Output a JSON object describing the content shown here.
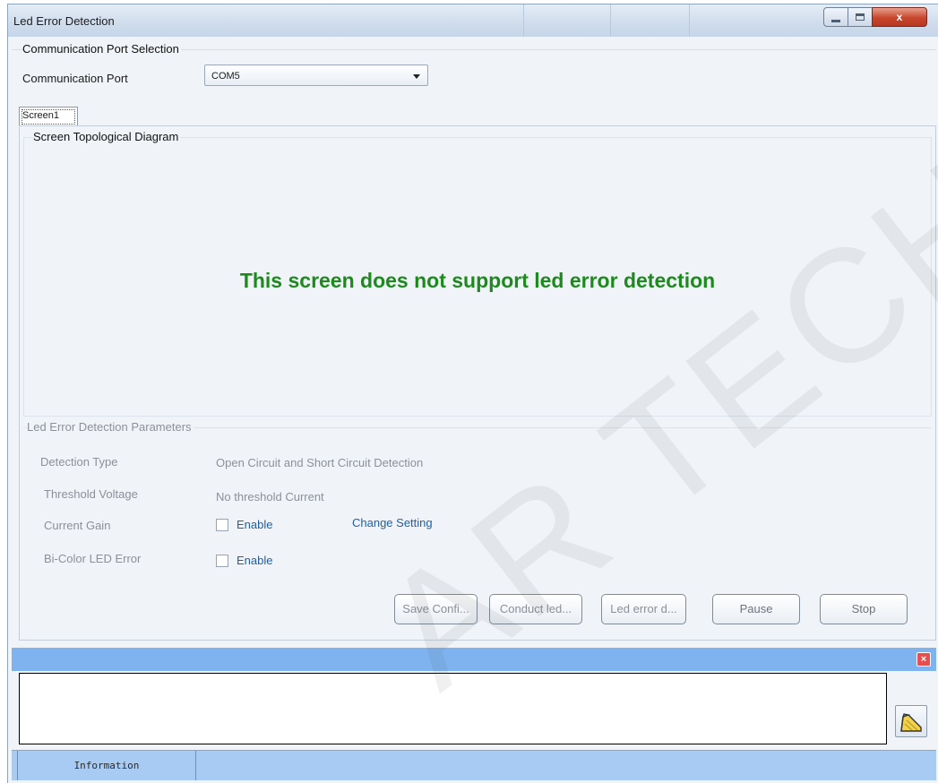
{
  "window": {
    "title": "Led Error Detection",
    "close_glyph": "x"
  },
  "port_section": {
    "group_label": "Communication Port Selection",
    "port_label": "Communication Port",
    "port_value": "COM5"
  },
  "tabs": [
    {
      "label": "Screen1",
      "selected": true
    }
  ],
  "topology": {
    "group_label": "Screen Topological Diagram",
    "message": "This screen does not support led error detection",
    "message_color": "#1d8a1d"
  },
  "parameters": {
    "group_label": "Led Error Detection Parameters",
    "detection_type_label": "Detection Type",
    "detection_type_value": "Open Circuit and Short Circuit Detection",
    "threshold_voltage_label": "Threshold Voltage",
    "threshold_voltage_value": "No threshold Current",
    "current_gain_label": "Current Gain",
    "current_gain_enable": "Enable",
    "change_setting": "Change Setting",
    "bicolor_label": "Bi-Color LED Error",
    "bicolor_enable": "Enable"
  },
  "actions": {
    "save": "Save Confi...",
    "conduct": "Conduct led...",
    "led_error": "Led error d...",
    "pause": "Pause",
    "stop": "Stop"
  },
  "info_panel": {
    "close_glyph": "×",
    "status_tab": "Information",
    "accent": "#7fb3f0"
  },
  "watermark": "AR TECH CO., LTD"
}
